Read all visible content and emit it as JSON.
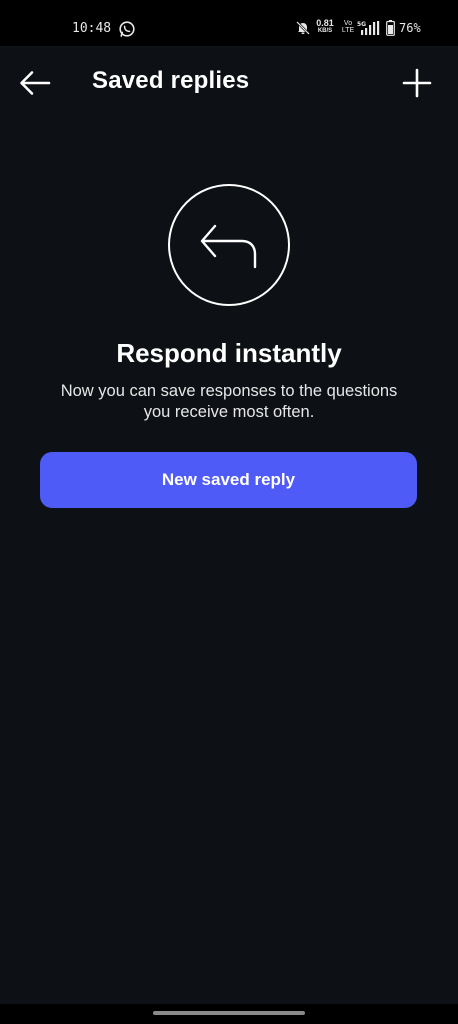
{
  "status_bar": {
    "time": "10:48",
    "net_speed_value": "0.81",
    "net_speed_unit": "KB/S",
    "volte_label": "Vo LTE",
    "battery_percent": "76%",
    "icons": [
      "whatsapp-icon",
      "mute-icon",
      "signal-5g-icon",
      "battery-icon"
    ]
  },
  "header": {
    "title": "Saved replies",
    "back_icon": "arrow-left-icon",
    "add_icon": "plus-icon"
  },
  "empty_state": {
    "icon": "reply-arrow-icon",
    "title": "Respond instantly",
    "description": "Now you can save responses to the questions you receive most often.",
    "button_label": "New saved reply",
    "button_color": "#4f5bf7"
  },
  "colors": {
    "background": "#0d1115",
    "status_bar": "#000000",
    "text": "#ffffff",
    "accent": "#4f5bf7"
  }
}
